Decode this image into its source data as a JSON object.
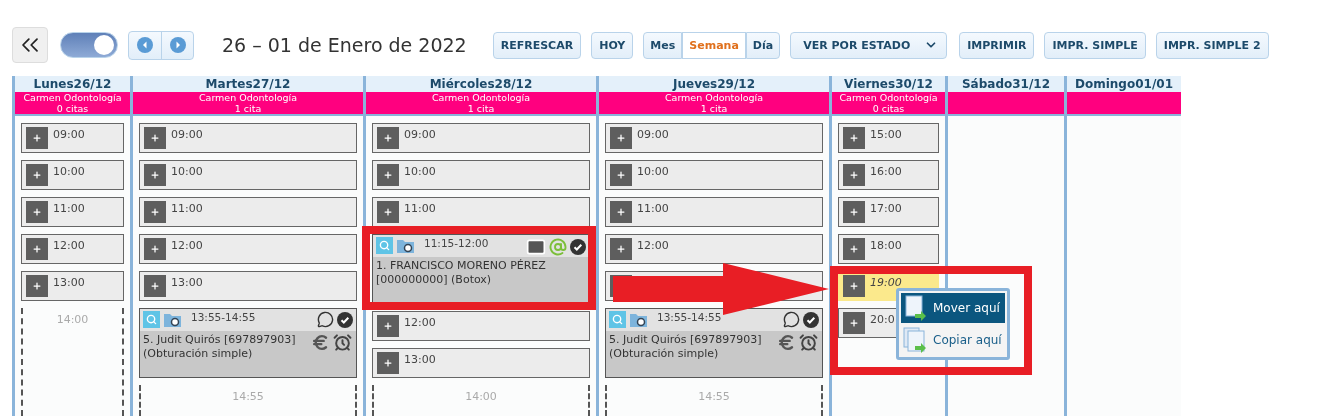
{
  "toolbar": {
    "toggle": {
      "on": true
    },
    "title": "26 – 01 de Enero de 2022",
    "refresh": "REFRESCAR",
    "today": "HOY",
    "views": [
      {
        "label": "Mes",
        "selected": false
      },
      {
        "label": "Semana",
        "selected": true
      },
      {
        "label": "Día",
        "selected": false
      }
    ],
    "filter": "VER POR ESTADO",
    "print_buttons": [
      "IMPRIMIR",
      "IMPR. SIMPLE",
      "IMPR. SIMPLE 2"
    ]
  },
  "days": [
    {
      "name": "Lunes26/12",
      "resource": "Carmen Odontología",
      "count": "0 citas",
      "items": [
        {
          "kind": "slot",
          "time": "09:00",
          "highlighted": false
        },
        {
          "kind": "slot",
          "time": "10:00",
          "highlighted": false
        },
        {
          "kind": "slot",
          "time": "11:00",
          "highlighted": false
        },
        {
          "kind": "slot",
          "time": "12:00",
          "highlighted": false
        },
        {
          "kind": "slot",
          "time": "13:00",
          "highlighted": false
        },
        {
          "kind": "end",
          "time": "14:00"
        }
      ]
    },
    {
      "name": "Martes27/12",
      "resource": "Carmen Odontología",
      "count": "1 cita",
      "items": [
        {
          "kind": "slot",
          "time": "09:00",
          "highlighted": false
        },
        {
          "kind": "slot",
          "time": "10:00",
          "highlighted": false
        },
        {
          "kind": "slot",
          "time": "11:00",
          "highlighted": false
        },
        {
          "kind": "slot",
          "time": "12:00",
          "highlighted": false
        },
        {
          "kind": "slot",
          "time": "13:00",
          "highlighted": false
        },
        {
          "kind": "appointment",
          "time": "13:55-14:55",
          "text": "5. Judit Quirós [697897903] (Obturación simple)",
          "mail": false,
          "email": false,
          "whatsapp": true,
          "confirmed": true,
          "paid": true,
          "reminder": true
        },
        {
          "kind": "end",
          "time": "14:55"
        }
      ]
    },
    {
      "name": "Miércoles28/12",
      "resource": "Carmen Odontología",
      "count": "1 cita",
      "items": [
        {
          "kind": "slot",
          "time": "09:00",
          "highlighted": false
        },
        {
          "kind": "slot",
          "time": "10:00",
          "highlighted": false
        },
        {
          "kind": "slot",
          "time": "11:00",
          "highlighted": false
        },
        {
          "kind": "appointment",
          "time": "11:15-12:00",
          "text": "1. FRANCISCO MORENO PÉREZ [000000000] (Botox)",
          "mail": true,
          "email": true,
          "whatsapp": false,
          "confirmed": true,
          "paid": false,
          "reminder": false
        },
        {
          "kind": "slot",
          "time": "12:00",
          "highlighted": false
        },
        {
          "kind": "slot",
          "time": "13:00",
          "highlighted": false
        },
        {
          "kind": "end",
          "time": "14:00"
        }
      ]
    },
    {
      "name": "Jueves29/12",
      "resource": "Carmen Odontología",
      "count": "1 cita",
      "items": [
        {
          "kind": "slot",
          "time": "09:00",
          "highlighted": false
        },
        {
          "kind": "slot",
          "time": "10:00",
          "highlighted": false
        },
        {
          "kind": "slot",
          "time": "11:00",
          "highlighted": false
        },
        {
          "kind": "slot",
          "time": "12:00",
          "highlighted": false
        },
        {
          "kind": "slot",
          "highlighted": false
        },
        {
          "kind": "appointment",
          "time": "13:55-14:55",
          "text": "5. Judit Quirós [697897903] (Obturación simple)",
          "mail": false,
          "email": false,
          "whatsapp": true,
          "confirmed": true,
          "paid": true,
          "reminder": true
        },
        {
          "kind": "end",
          "time": "14:55"
        }
      ]
    },
    {
      "name": "Viernes30/12",
      "resource": "Carmen Odontología",
      "count": "0 citas",
      "items": [
        {
          "kind": "slot",
          "time": "15:00",
          "highlighted": false
        },
        {
          "kind": "slot",
          "time": "16:00",
          "highlighted": false
        },
        {
          "kind": "slot",
          "time": "17:00",
          "highlighted": false
        },
        {
          "kind": "slot",
          "time": "18:00",
          "highlighted": false
        },
        {
          "kind": "slot",
          "time": "19:00",
          "highlighted": true
        },
        {
          "kind": "slot",
          "time": "20:0",
          "highlighted": false
        }
      ]
    },
    {
      "name": "Sábado31/12"
    },
    {
      "name": "Domingo01/01"
    }
  ],
  "context_menu": [
    {
      "label": "Mover aquí",
      "selected": true
    },
    {
      "label": "Copiar aquí",
      "selected": false
    }
  ]
}
